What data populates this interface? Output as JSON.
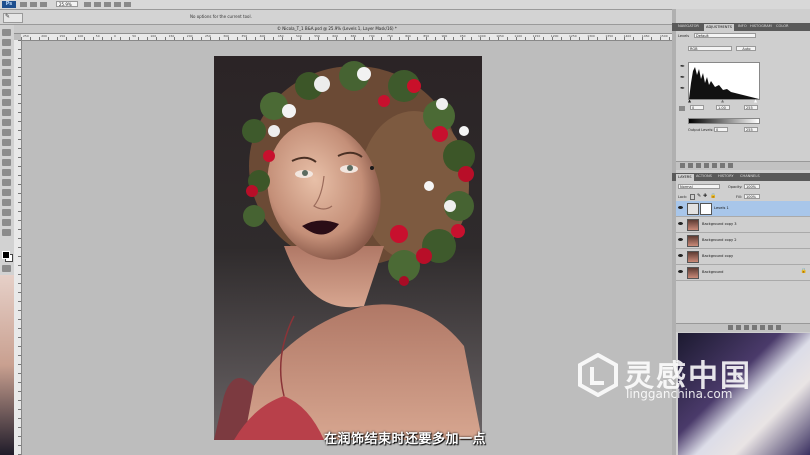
{
  "app": {
    "logo": "Ps",
    "zoom": "25.9%"
  },
  "options_bar": {
    "message": "No options for the current tool."
  },
  "document": {
    "tab_title": "© Nicola_T_1 B&A.psd @ 25.9% (Levels 1, Layer Mask/16) *",
    "ruler_numbers": [
      "250",
      "200",
      "150",
      "100",
      "50",
      "0",
      "50",
      "100",
      "150",
      "200",
      "250",
      "300",
      "350",
      "400",
      "450",
      "500",
      "550",
      "600",
      "650",
      "700",
      "750",
      "800",
      "850",
      "900",
      "950",
      "1000",
      "1050",
      "1100",
      "1150",
      "1200",
      "1250",
      "1300",
      "1350",
      "1400",
      "1450",
      "1500"
    ]
  },
  "adjustments_panel": {
    "tabs": [
      "Navigator",
      "Adjustments",
      "Info",
      "Histogram",
      "Color"
    ],
    "preset_label": "Levels",
    "preset_value": "Default",
    "channel": "RGB",
    "auto_label": "Auto",
    "input_black": "0",
    "input_gamma": "1.00",
    "input_white": "255",
    "output_label": "Output Levels:",
    "output_black": "0",
    "output_white": "255"
  },
  "layers_panel": {
    "tabs": [
      "Layers",
      "Actions",
      "History",
      "Channels"
    ],
    "blend_mode": "Normal",
    "opacity_label": "Opacity:",
    "opacity": "100%",
    "lock_label": "Lock:",
    "fill_label": "Fill:",
    "fill": "100%",
    "layers": [
      {
        "name": "Levels 1",
        "selected": true,
        "kind": "adjustment"
      },
      {
        "name": "Background copy 3",
        "selected": false,
        "kind": "pixel"
      },
      {
        "name": "Background copy 2",
        "selected": false,
        "kind": "pixel"
      },
      {
        "name": "Background copy",
        "selected": false,
        "kind": "pixel"
      },
      {
        "name": "Background",
        "selected": false,
        "kind": "pixel",
        "locked": true
      }
    ]
  },
  "subtitle": "在润饰结束时还要多加一点",
  "watermark": {
    "cn": "灵感中国",
    "en": "lingganchina.com"
  },
  "colors": {
    "selection": "#a8c6ea",
    "panel_bg": "#cfcfcf",
    "canvas_bg": "#bdbdbd"
  }
}
